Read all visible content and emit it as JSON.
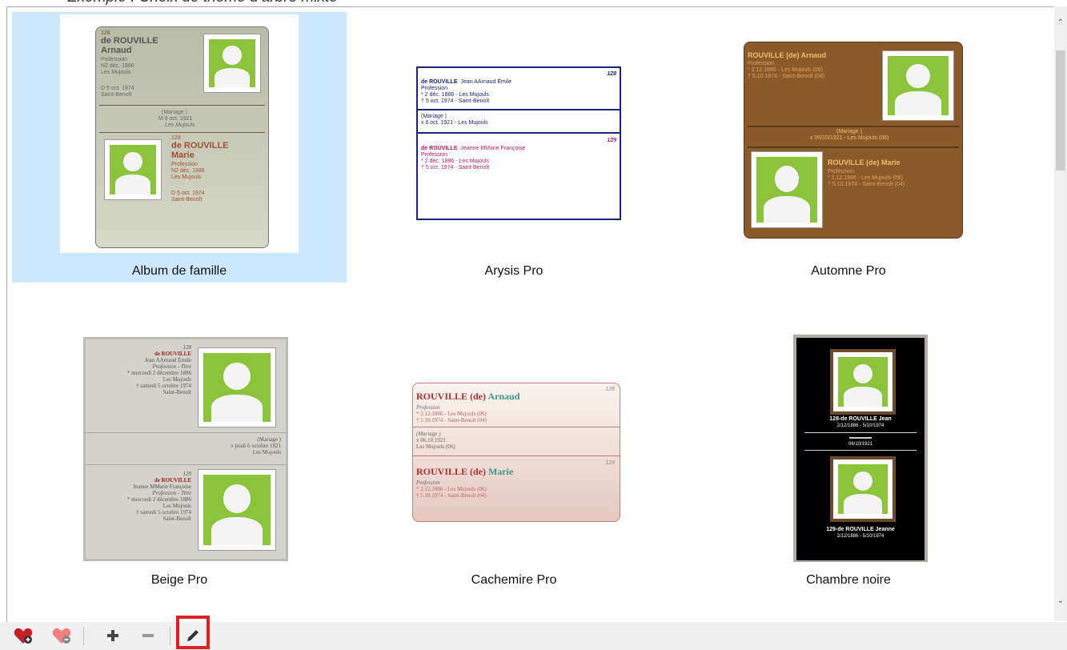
{
  "caption": "Exemple : Choix de thème d’arbre mixte",
  "themes": [
    {
      "label": "Album de famille",
      "selected": true
    },
    {
      "label": "Arysis Pro",
      "selected": false
    },
    {
      "label": "Automne Pro",
      "selected": false
    },
    {
      "label": "Beige Pro",
      "selected": false
    },
    {
      "label": "Cachemire Pro",
      "selected": false
    },
    {
      "label": "Chambre noire",
      "selected": false
    }
  ],
  "preview": {
    "album": {
      "num1": "128",
      "name1a": "de ROUVILLE",
      "name1b": "Arnaud",
      "prof1": "Profession",
      "birth1": "N2 déc. 1886",
      "place1": "Les Mujouls",
      "death1": "D 5 oct. 1974",
      "place1b": "Saint-Benoît",
      "marriage": "(Mariage )",
      "mdate": "M 6 oct. 1921",
      "mplace": "Les Mujouls",
      "num2": "129",
      "name2a": "de ROUVILLE",
      "name2b": "Marie",
      "prof2": "Profession",
      "birth2": "N2 déc. 1886",
      "place2": "Les Mujouls",
      "death2": "D 5 oct. 1974",
      "place2b": "Saint-Benoît"
    },
    "arysis": {
      "num1": "128",
      "name1": "de ROUVILLE",
      "given1": "Jean AArnaud Émile",
      "prof1": "Profession",
      "birth1": "* 2 déc. 1886 - Les Mujouls",
      "death1": "† 5 oct. 1974 - Saint-Benoît",
      "marriage": "(Mariage )",
      "mdate": "x 6 oct. 1921 - Les Mujouls",
      "num2": "129",
      "name2": "de ROUVILLE",
      "given2": "Jeanne MMarie Françoise",
      "prof2": "Profession",
      "birth2": "* 2 déc. 1886 - Les Mujouls",
      "death2": "† 5 oct. 1974 - Saint-Benoît"
    },
    "automne": {
      "name1": "ROUVILLE (de) Arnaud",
      "prof1": "Profession",
      "birth1": "* 2.12.1886 - Les Mujouls (06)",
      "death1": "† 5.10.1974 - Saint-Benoît (04)",
      "marriage": "(Mariage )",
      "mdate": "x 06/10/1921 - Les Mujouls (06)",
      "name2": "ROUVILLE (de) Marie",
      "prof2": "Profession",
      "birth2": "* 2.12.1886 - Les Mujouls (06)",
      "death2": "† 5.10.1974 - Saint-Benoît (04)"
    },
    "beige": {
      "num1": "128",
      "name1": "de ROUVILLE",
      "given1": "Jean AArnaud Émile",
      "prof1": "Profession - Titre",
      "birth1": "* mercredi 2 décembre 1886",
      "place1": "Les Mujouls",
      "death1": "† samedi 5 octobre 1974",
      "place1b": "Saint-Benoît",
      "marriage": "(Mariage )",
      "mdate": "x jeudi 6 octobre 1921",
      "mplace": "Les Mujouls",
      "num2": "129",
      "name2": "de ROUVILLE",
      "given2": "Jeanne MMarie Françoise",
      "prof2": "Profession - Titre",
      "birth2": "* mercredi 2 décembre 1886",
      "place2": "Les Mujouls",
      "death2": "† samedi 5 octobre 1974",
      "place2b": "Saint-Benoît"
    },
    "cachemire": {
      "num1": "128",
      "surname1": "ROUVILLE (de)",
      "given1": "Arnaud",
      "prof1": "Profession",
      "birth1": "* 2.12.1886 - Les Mujouls (06)",
      "death1": "† 5.10.1974 - Saint-Benoît (04)",
      "marriage": "(Mariage )",
      "mdate": "x 06.10.1921",
      "mplace": "Les Mujouls (06)",
      "num2": "129",
      "surname2": "ROUVILLE (de)",
      "given2": "Marie",
      "prof2": "Profession",
      "birth2": "* 2.12.1886 - Les Mujouls (06)",
      "death2": "† 5.10.1974 - Saint-Benoît (04)"
    },
    "noire": {
      "name1": "128-de ROUVILLE Jean",
      "dates1": "2/12/1886 - 5/10/1974",
      "mdate": "06/10/1921",
      "name2": "129-de ROUVILLE Jeanne",
      "dates2": "2/12/1886 - 5/10/1974"
    }
  },
  "toolbar": {
    "buttons": [
      {
        "name": "favorite-add",
        "icon": "heart-icon"
      },
      {
        "name": "favorite-remove",
        "icon": "heart-broken-icon"
      },
      {
        "name": "add",
        "icon": "plus-icon"
      },
      {
        "name": "remove",
        "icon": "minus-icon"
      },
      {
        "name": "edit",
        "icon": "pencil-icon"
      }
    ]
  },
  "colors": {
    "selection": "#cce8ff",
    "highlight": "#e02020",
    "photo_green": "#8bc43a"
  }
}
